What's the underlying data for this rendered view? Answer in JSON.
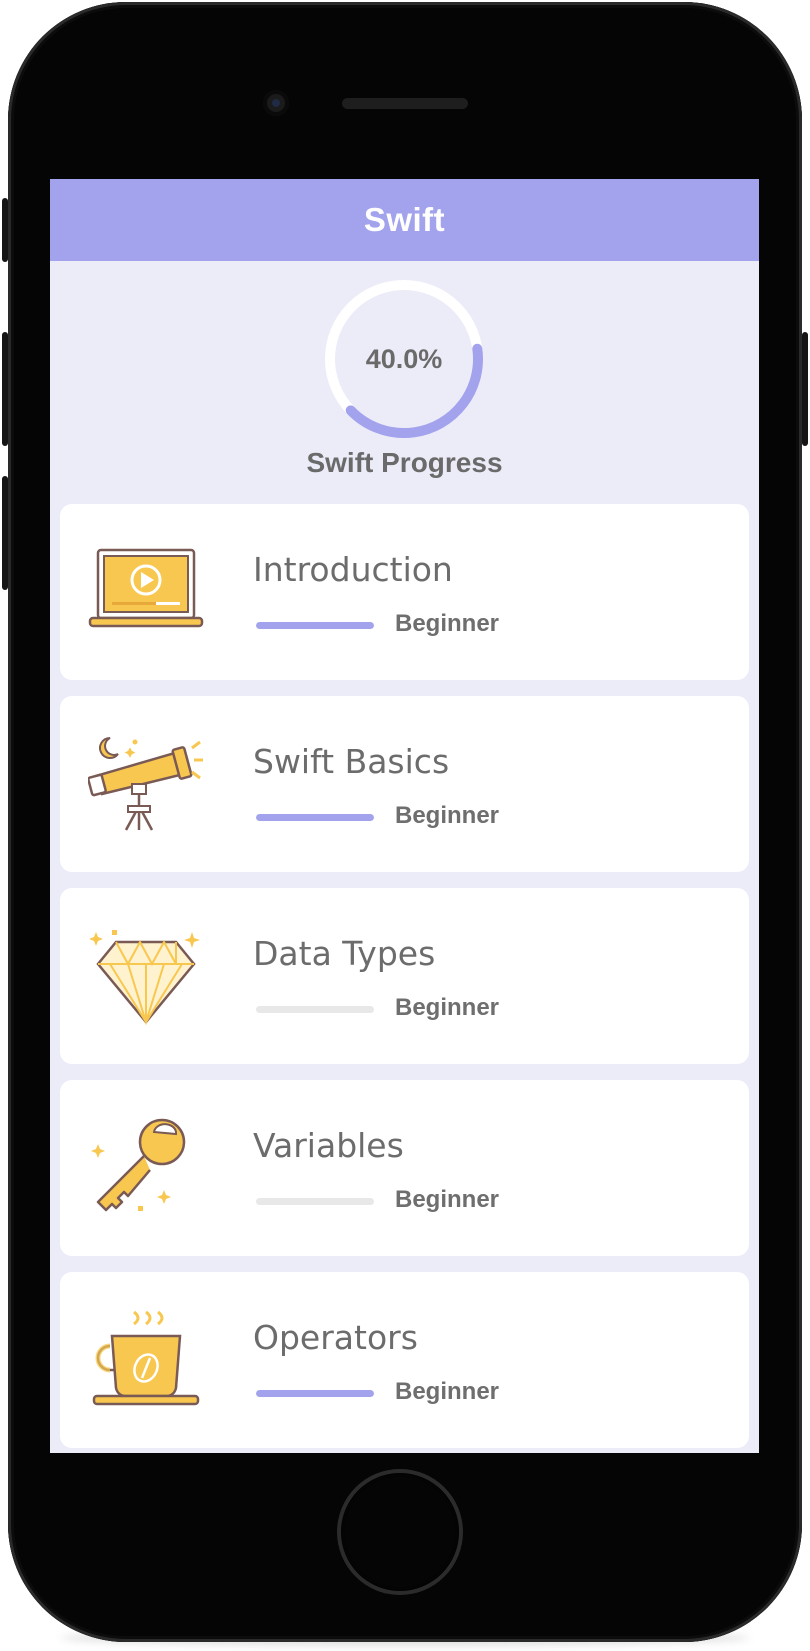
{
  "nav": {
    "title": "Swift"
  },
  "progress": {
    "value_text": "40.0%",
    "fraction": 0.4,
    "label": "Swift Progress"
  },
  "colors": {
    "accent": "#a2a2ed",
    "screen_bg": "#ececf9",
    "icon_yellow": "#f8c74f",
    "icon_outline": "#7a5a55"
  },
  "courses": [
    {
      "title": "Introduction",
      "level": "Beginner",
      "level_progress": 1.0,
      "icon": "laptop-play-icon"
    },
    {
      "title": "Swift Basics",
      "level": "Beginner",
      "level_progress": 1.0,
      "icon": "telescope-icon"
    },
    {
      "title": "Data Types",
      "level": "Beginner",
      "level_progress": 0.0,
      "icon": "diamond-icon"
    },
    {
      "title": "Variables",
      "level": "Beginner",
      "level_progress": 0.0,
      "icon": "key-icon"
    },
    {
      "title": "Operators",
      "level": "Beginner",
      "level_progress": 1.0,
      "icon": "coffee-cup-icon"
    }
  ]
}
